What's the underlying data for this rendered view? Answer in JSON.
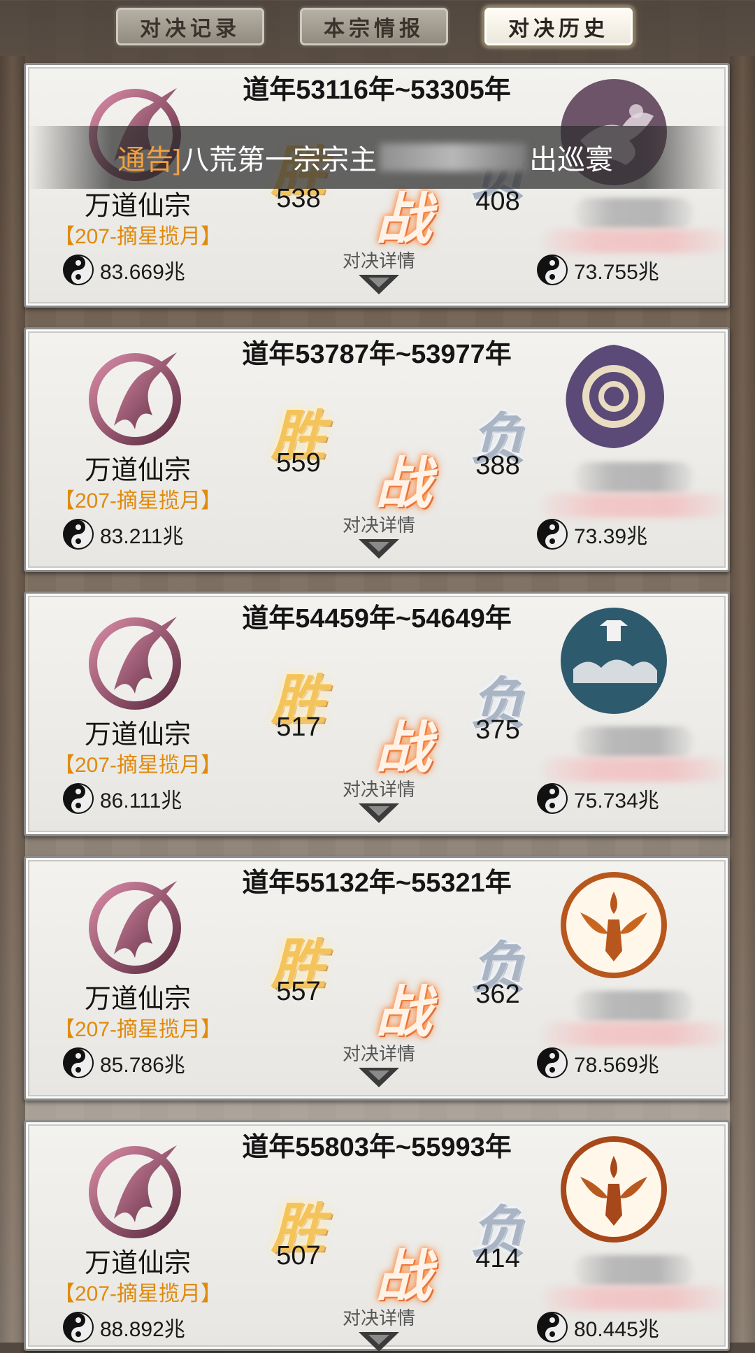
{
  "tabs": [
    {
      "label": "对决记录",
      "active": false
    },
    {
      "label": "本宗情报",
      "active": false
    },
    {
      "label": "对决历史",
      "active": true
    }
  ],
  "notice": {
    "tag": "通告]",
    "text_before": "八荒第一宗宗主",
    "text_after": "出巡寰"
  },
  "labels": {
    "win": "胜",
    "lose": "负",
    "battle": "战",
    "detail": "对决详情"
  },
  "records": [
    {
      "period": "道年53116年~53305年",
      "our_sect": "万道仙宗",
      "our_tag": "【207-摘星揽月】",
      "our_power": "83.669兆",
      "wins": "538",
      "losses": "408",
      "enemy_power": "73.755兆",
      "enemy_emblem": "plum-blossom-emblem",
      "enemy_emblem_color": "#6e5468"
    },
    {
      "period": "道年53787年~53977年",
      "our_sect": "万道仙宗",
      "our_tag": "【207-摘星揽月】",
      "our_power": "83.211兆",
      "wins": "559",
      "losses": "388",
      "enemy_power": "73.39兆",
      "enemy_emblem": "swirl-flower-emblem",
      "enemy_emblem_color": "#5b4a78"
    },
    {
      "period": "道年54459年~54649年",
      "our_sect": "万道仙宗",
      "our_tag": "【207-摘星揽月】",
      "our_power": "86.111兆",
      "wins": "517",
      "losses": "375",
      "enemy_power": "75.734兆",
      "enemy_emblem": "cloud-pagoda-emblem",
      "enemy_emblem_color": "#2e5a6e"
    },
    {
      "period": "道年55132年~55321年",
      "our_sect": "万道仙宗",
      "our_tag": "【207-摘星揽月】",
      "our_power": "85.786兆",
      "wins": "557",
      "losses": "362",
      "enemy_power": "78.569兆",
      "enemy_emblem": "phoenix-emblem",
      "enemy_emblem_color": "#b8571d"
    },
    {
      "period": "道年55803年~55993年",
      "our_sect": "万道仙宗",
      "our_tag": "【207-摘星揽月】",
      "our_power": "88.892兆",
      "wins": "507",
      "losses": "414",
      "enemy_power": "80.445兆",
      "enemy_emblem": "phoenix-emblem",
      "enemy_emblem_color": "#a6481a"
    }
  ]
}
